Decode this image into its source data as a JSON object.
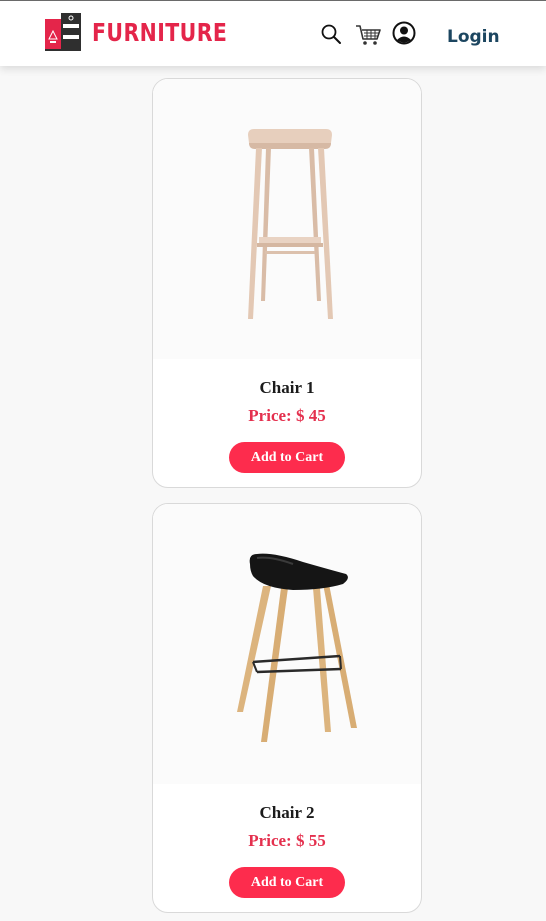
{
  "brand": {
    "name": "FURNITURE",
    "color": "#e4254a"
  },
  "nav": {
    "icons": [
      "search-icon",
      "cart-icon",
      "account-icon"
    ],
    "login_label": "Login"
  },
  "products": [
    {
      "name": "Chair 1",
      "price": "Price: $ 45",
      "button": "Add to Cart",
      "image": "wooden-stool-image"
    },
    {
      "name": "Chair 2",
      "price": "Price: $ 55",
      "button": "Add to Cart",
      "image": "black-bar-stool-image"
    }
  ],
  "colors": {
    "accent": "#fd2c4d",
    "price": "#e4304e",
    "login": "#1c4660"
  }
}
